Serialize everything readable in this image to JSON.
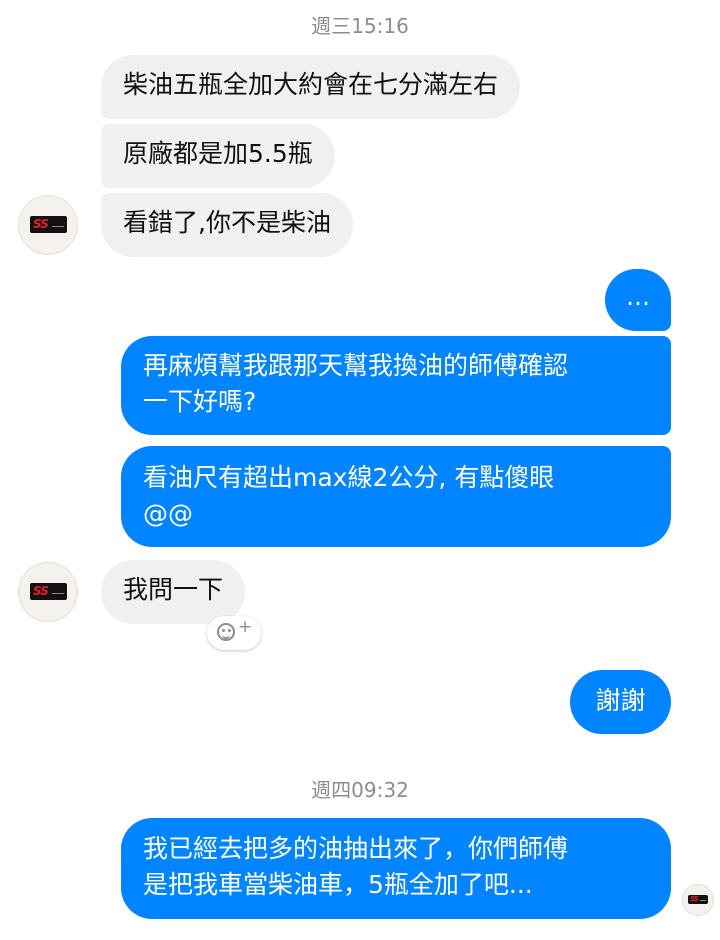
{
  "conversation": {
    "timestamp_1": "週三15:16",
    "timestamp_2": "週四09:32",
    "messages": [
      {
        "from": "other",
        "text": "柴油五瓶全加大約會在七分滿左右"
      },
      {
        "from": "other",
        "text": "原廠都是加5.5瓶"
      },
      {
        "from": "other",
        "text": "看錯了,你不是柴油"
      },
      {
        "from": "me",
        "text": "..."
      },
      {
        "from": "me",
        "text": "再麻煩幫我跟那天幫我換油的師傅確認\n一下好嗎?"
      },
      {
        "from": "me",
        "text": "看油尺有超出max線2公分, 有點傻眼\n@@"
      },
      {
        "from": "other",
        "text": "我問一下"
      },
      {
        "from": "me",
        "text": "謝謝"
      },
      {
        "from": "me",
        "text": "我已經去把多的油抽出來了，你們師傅\n是把我車當柴油車，5瓶全加了吧..."
      }
    ]
  },
  "avatar": {
    "badge_text": "SS"
  },
  "reaction": {
    "icon": "smiley-add-reaction-icon",
    "plus": "+"
  },
  "colors": {
    "outgoing_bubble": "#0084ff",
    "incoming_bubble": "#f0f0f0",
    "timestamp_text": "#8a8d91"
  }
}
